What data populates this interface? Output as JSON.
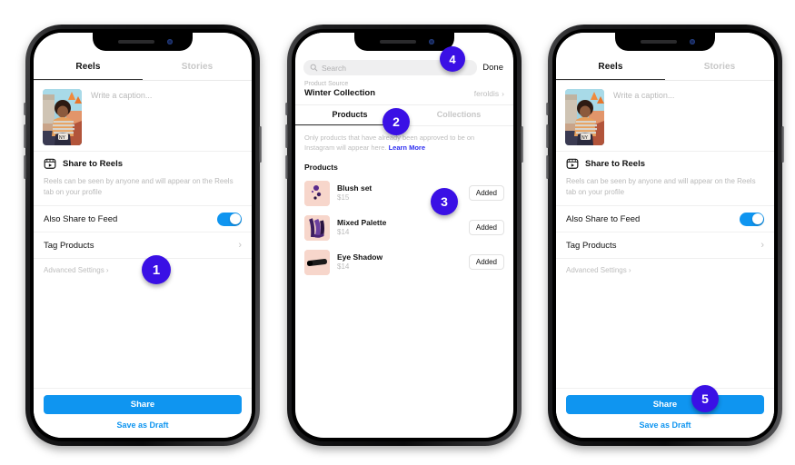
{
  "phones": [
    {
      "id": "share-screen-before",
      "tabs": [
        {
          "label": "Reels",
          "active": true
        },
        {
          "label": "Stories",
          "active": false
        }
      ],
      "caption_placeholder": "Write a caption...",
      "share_to_reels_label": "Share to Reels",
      "share_to_reels_desc": "Reels can be seen by anyone and will appear on the Reels tab on your profile",
      "options": [
        {
          "label": "Also Share to Feed",
          "control": "toggle",
          "state": "on"
        },
        {
          "label": "Tag Products",
          "control": "chevron"
        }
      ],
      "advanced_settings": "Advanced Settings  ›",
      "share_button": "Share",
      "save_draft": "Save as Draft"
    },
    {
      "id": "product-picker",
      "search_placeholder": "Search",
      "done_label": "Done",
      "source_label": "Product Source",
      "source_value": "Winter Collection",
      "source_account": "feroldis",
      "picker_tabs": [
        {
          "label": "Products",
          "active": true
        },
        {
          "label": "Collections",
          "active": false
        }
      ],
      "notice_text": "Only products that have already been approved to be on Instagram will appear here.",
      "notice_link": "Learn More",
      "section_title": "Products",
      "products": [
        {
          "name": "Blush set",
          "price": "$15",
          "action": "Added"
        },
        {
          "name": "Mixed Palette",
          "price": "$14",
          "action": "Added"
        },
        {
          "name": "Eye Shadow",
          "price": "$14",
          "action": "Added"
        }
      ]
    },
    {
      "id": "share-screen-after",
      "tabs": [
        {
          "label": "Reels",
          "active": true
        },
        {
          "label": "Stories",
          "active": false
        }
      ],
      "caption_placeholder": "Write a caption...",
      "share_to_reels_label": "Share to Reels",
      "share_to_reels_desc": "Reels can be seen by anyone and will appear on the Reels tab on your profile",
      "options": [
        {
          "label": "Also Share to Feed",
          "control": "toggle",
          "state": "on"
        },
        {
          "label": "Tag Products",
          "control": "chevron"
        }
      ],
      "advanced_settings": "Advanced Settings  ›",
      "share_button": "Share",
      "save_draft": "Save as Draft"
    }
  ],
  "step_badges": [
    {
      "number": "1"
    },
    {
      "number": "2"
    },
    {
      "number": "3"
    },
    {
      "number": "4"
    },
    {
      "number": "5"
    }
  ],
  "colors": {
    "badge": "#3a10e5",
    "instagram_blue": "#0f95f0",
    "link_blue": "#2d2df0"
  }
}
